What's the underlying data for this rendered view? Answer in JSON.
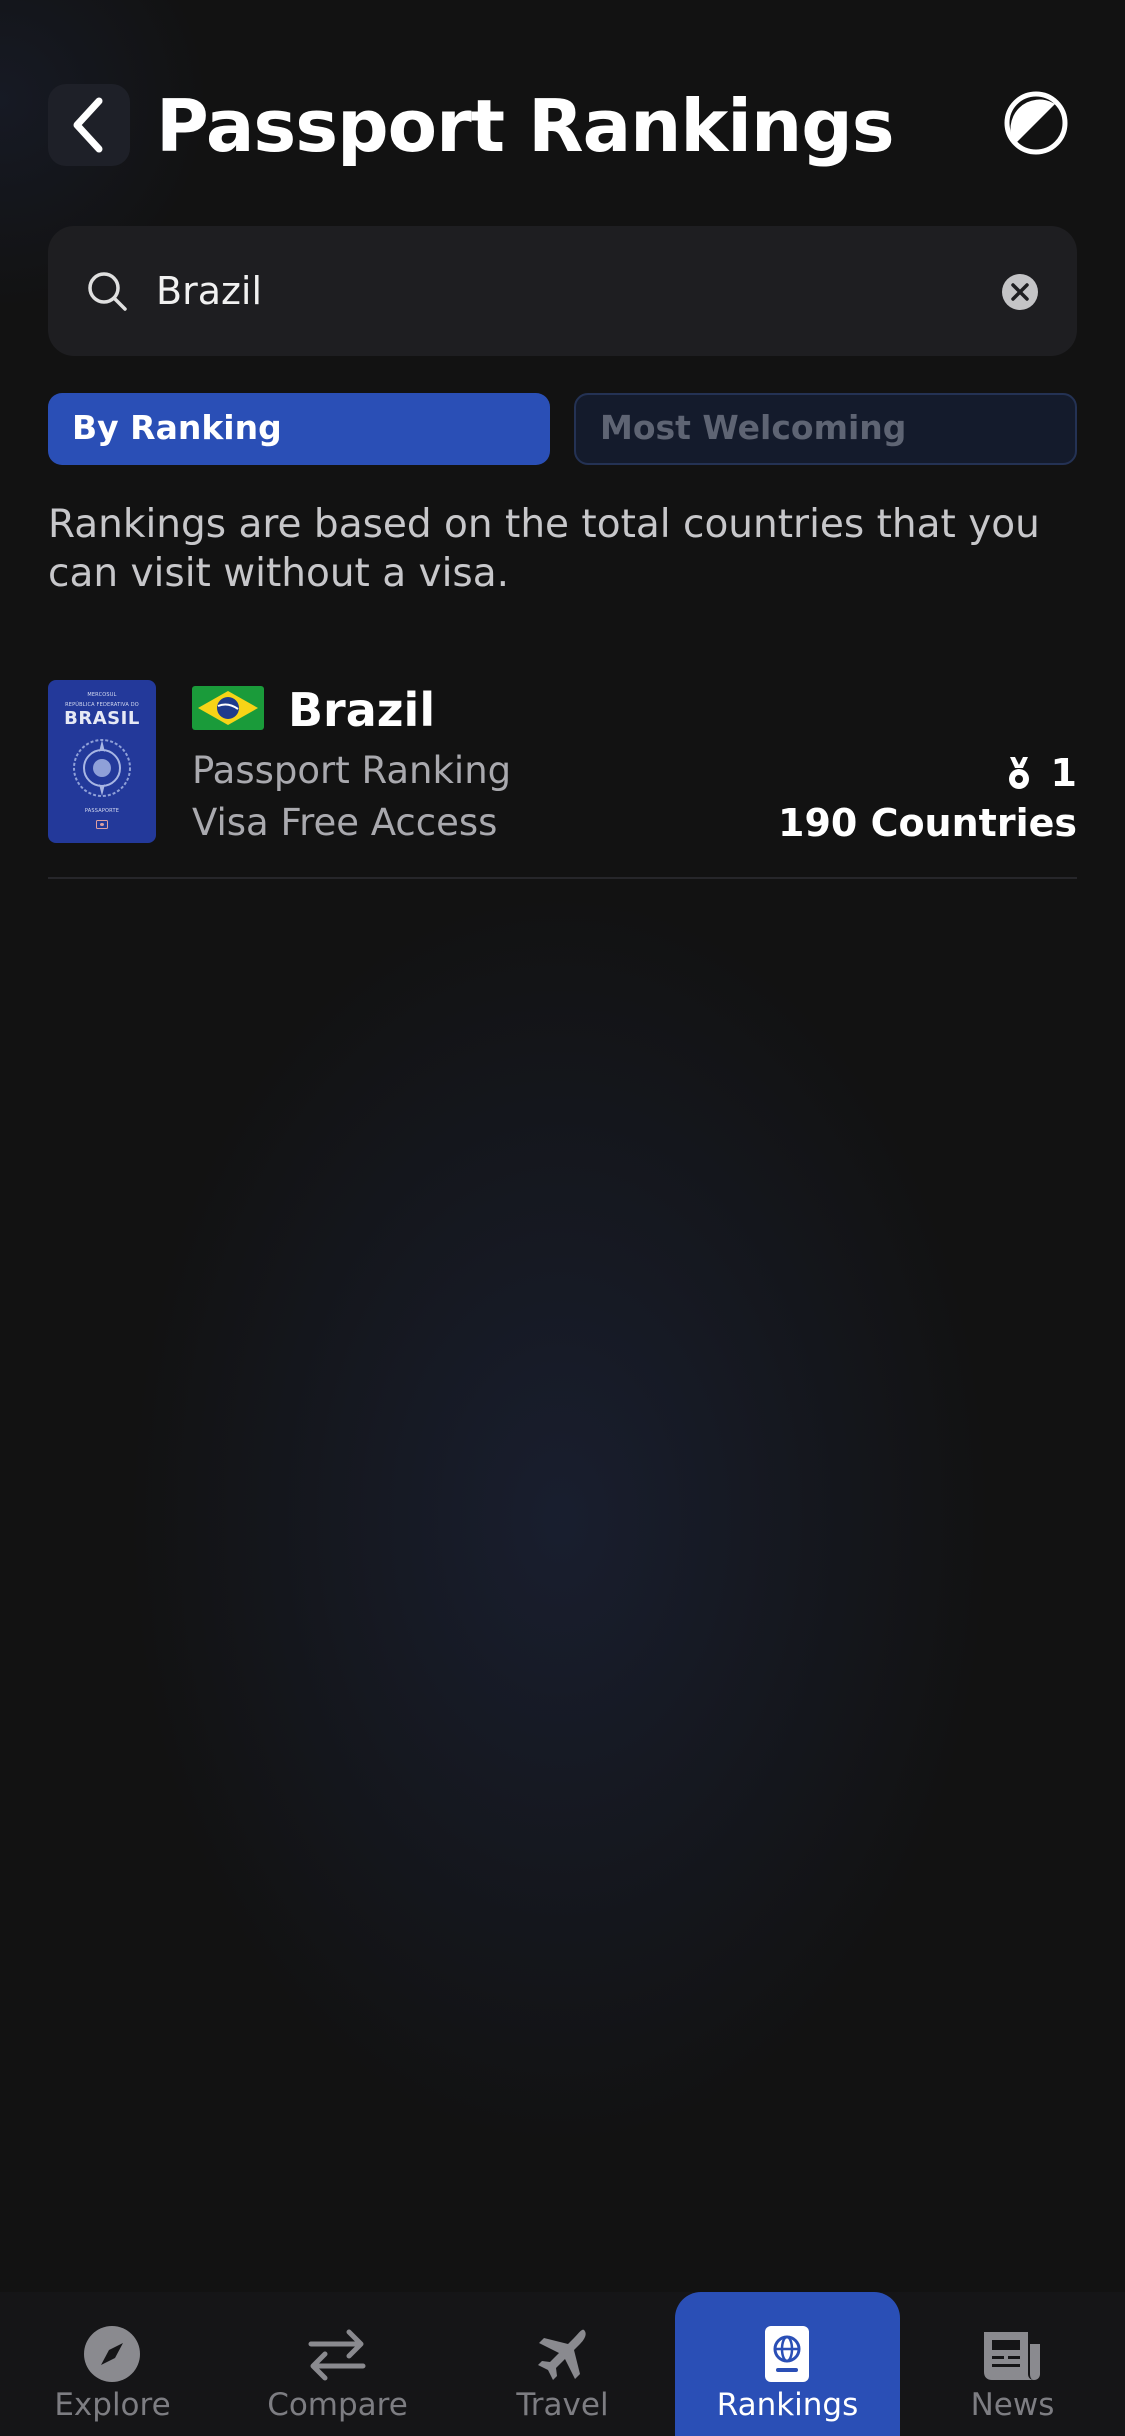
{
  "header": {
    "title": "Passport Rankings",
    "back_icon": "chevron-left-icon",
    "theme_icon": "theme-toggle-icon"
  },
  "search": {
    "value": "Brazil",
    "icon": "search-icon",
    "clear_icon": "clear-icon"
  },
  "tabs": [
    {
      "label": "By Ranking",
      "active": true
    },
    {
      "label": "Most Welcoming",
      "active": false
    }
  ],
  "description": "Rankings are based on the total countries that you can visit without a visa.",
  "results": [
    {
      "passport_cover": {
        "top_text": "MERCOSUL",
        "sub_text": "REPÚBLICA FEDERATIVA DO",
        "name": "BRASIL",
        "bottom_text": "PASSAPORTE"
      },
      "country": "Brazil",
      "ranking_label": "Passport Ranking",
      "visa_label": "Visa Free Access",
      "rank": "1",
      "visa_free_count": "190 Countries"
    }
  ],
  "nav": [
    {
      "label": "Explore",
      "icon": "compass-icon",
      "active": false
    },
    {
      "label": "Compare",
      "icon": "arrows-exchange-icon",
      "active": false
    },
    {
      "label": "Travel",
      "icon": "airplane-icon",
      "active": false
    },
    {
      "label": "Rankings",
      "icon": "passport-icon",
      "active": true
    },
    {
      "label": "News",
      "icon": "newspaper-icon",
      "active": false
    }
  ],
  "colors": {
    "accent": "#2a4fb6",
    "background": "#121212",
    "passport_blue": "#23399a"
  }
}
